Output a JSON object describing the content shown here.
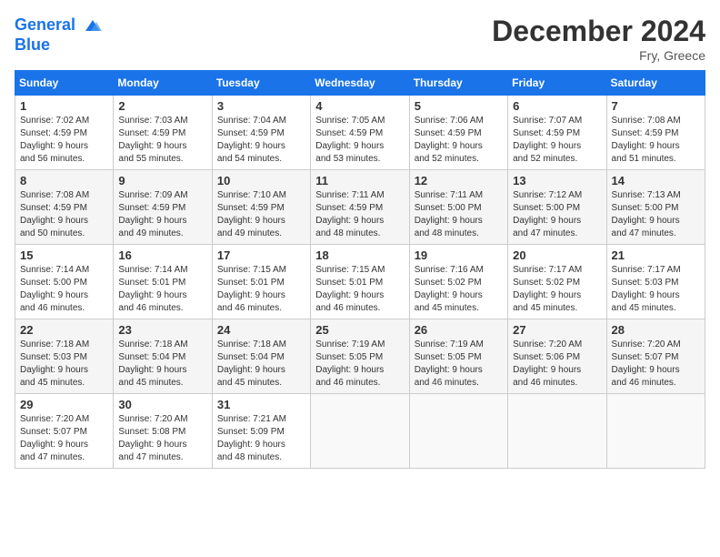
{
  "header": {
    "logo_line1": "General",
    "logo_line2": "Blue",
    "month_title": "December 2024",
    "location": "Fry, Greece"
  },
  "weekdays": [
    "Sunday",
    "Monday",
    "Tuesday",
    "Wednesday",
    "Thursday",
    "Friday",
    "Saturday"
  ],
  "weeks": [
    [
      {
        "day": 1,
        "sunrise": "7:02 AM",
        "sunset": "4:59 PM",
        "daylight": "9 hours and 56 minutes."
      },
      {
        "day": 2,
        "sunrise": "7:03 AM",
        "sunset": "4:59 PM",
        "daylight": "9 hours and 55 minutes."
      },
      {
        "day": 3,
        "sunrise": "7:04 AM",
        "sunset": "4:59 PM",
        "daylight": "9 hours and 54 minutes."
      },
      {
        "day": 4,
        "sunrise": "7:05 AM",
        "sunset": "4:59 PM",
        "daylight": "9 hours and 53 minutes."
      },
      {
        "day": 5,
        "sunrise": "7:06 AM",
        "sunset": "4:59 PM",
        "daylight": "9 hours and 52 minutes."
      },
      {
        "day": 6,
        "sunrise": "7:07 AM",
        "sunset": "4:59 PM",
        "daylight": "9 hours and 52 minutes."
      },
      {
        "day": 7,
        "sunrise": "7:08 AM",
        "sunset": "4:59 PM",
        "daylight": "9 hours and 51 minutes."
      }
    ],
    [
      {
        "day": 8,
        "sunrise": "7:08 AM",
        "sunset": "4:59 PM",
        "daylight": "9 hours and 50 minutes."
      },
      {
        "day": 9,
        "sunrise": "7:09 AM",
        "sunset": "4:59 PM",
        "daylight": "9 hours and 49 minutes."
      },
      {
        "day": 10,
        "sunrise": "7:10 AM",
        "sunset": "4:59 PM",
        "daylight": "9 hours and 49 minutes."
      },
      {
        "day": 11,
        "sunrise": "7:11 AM",
        "sunset": "4:59 PM",
        "daylight": "9 hours and 48 minutes."
      },
      {
        "day": 12,
        "sunrise": "7:11 AM",
        "sunset": "5:00 PM",
        "daylight": "9 hours and 48 minutes."
      },
      {
        "day": 13,
        "sunrise": "7:12 AM",
        "sunset": "5:00 PM",
        "daylight": "9 hours and 47 minutes."
      },
      {
        "day": 14,
        "sunrise": "7:13 AM",
        "sunset": "5:00 PM",
        "daylight": "9 hours and 47 minutes."
      }
    ],
    [
      {
        "day": 15,
        "sunrise": "7:14 AM",
        "sunset": "5:00 PM",
        "daylight": "9 hours and 46 minutes."
      },
      {
        "day": 16,
        "sunrise": "7:14 AM",
        "sunset": "5:01 PM",
        "daylight": "9 hours and 46 minutes."
      },
      {
        "day": 17,
        "sunrise": "7:15 AM",
        "sunset": "5:01 PM",
        "daylight": "9 hours and 46 minutes."
      },
      {
        "day": 18,
        "sunrise": "7:15 AM",
        "sunset": "5:01 PM",
        "daylight": "9 hours and 46 minutes."
      },
      {
        "day": 19,
        "sunrise": "7:16 AM",
        "sunset": "5:02 PM",
        "daylight": "9 hours and 45 minutes."
      },
      {
        "day": 20,
        "sunrise": "7:17 AM",
        "sunset": "5:02 PM",
        "daylight": "9 hours and 45 minutes."
      },
      {
        "day": 21,
        "sunrise": "7:17 AM",
        "sunset": "5:03 PM",
        "daylight": "9 hours and 45 minutes."
      }
    ],
    [
      {
        "day": 22,
        "sunrise": "7:18 AM",
        "sunset": "5:03 PM",
        "daylight": "9 hours and 45 minutes."
      },
      {
        "day": 23,
        "sunrise": "7:18 AM",
        "sunset": "5:04 PM",
        "daylight": "9 hours and 45 minutes."
      },
      {
        "day": 24,
        "sunrise": "7:18 AM",
        "sunset": "5:04 PM",
        "daylight": "9 hours and 45 minutes."
      },
      {
        "day": 25,
        "sunrise": "7:19 AM",
        "sunset": "5:05 PM",
        "daylight": "9 hours and 46 minutes."
      },
      {
        "day": 26,
        "sunrise": "7:19 AM",
        "sunset": "5:05 PM",
        "daylight": "9 hours and 46 minutes."
      },
      {
        "day": 27,
        "sunrise": "7:20 AM",
        "sunset": "5:06 PM",
        "daylight": "9 hours and 46 minutes."
      },
      {
        "day": 28,
        "sunrise": "7:20 AM",
        "sunset": "5:07 PM",
        "daylight": "9 hours and 46 minutes."
      }
    ],
    [
      {
        "day": 29,
        "sunrise": "7:20 AM",
        "sunset": "5:07 PM",
        "daylight": "9 hours and 47 minutes."
      },
      {
        "day": 30,
        "sunrise": "7:20 AM",
        "sunset": "5:08 PM",
        "daylight": "9 hours and 47 minutes."
      },
      {
        "day": 31,
        "sunrise": "7:21 AM",
        "sunset": "5:09 PM",
        "daylight": "9 hours and 48 minutes."
      },
      null,
      null,
      null,
      null
    ]
  ]
}
